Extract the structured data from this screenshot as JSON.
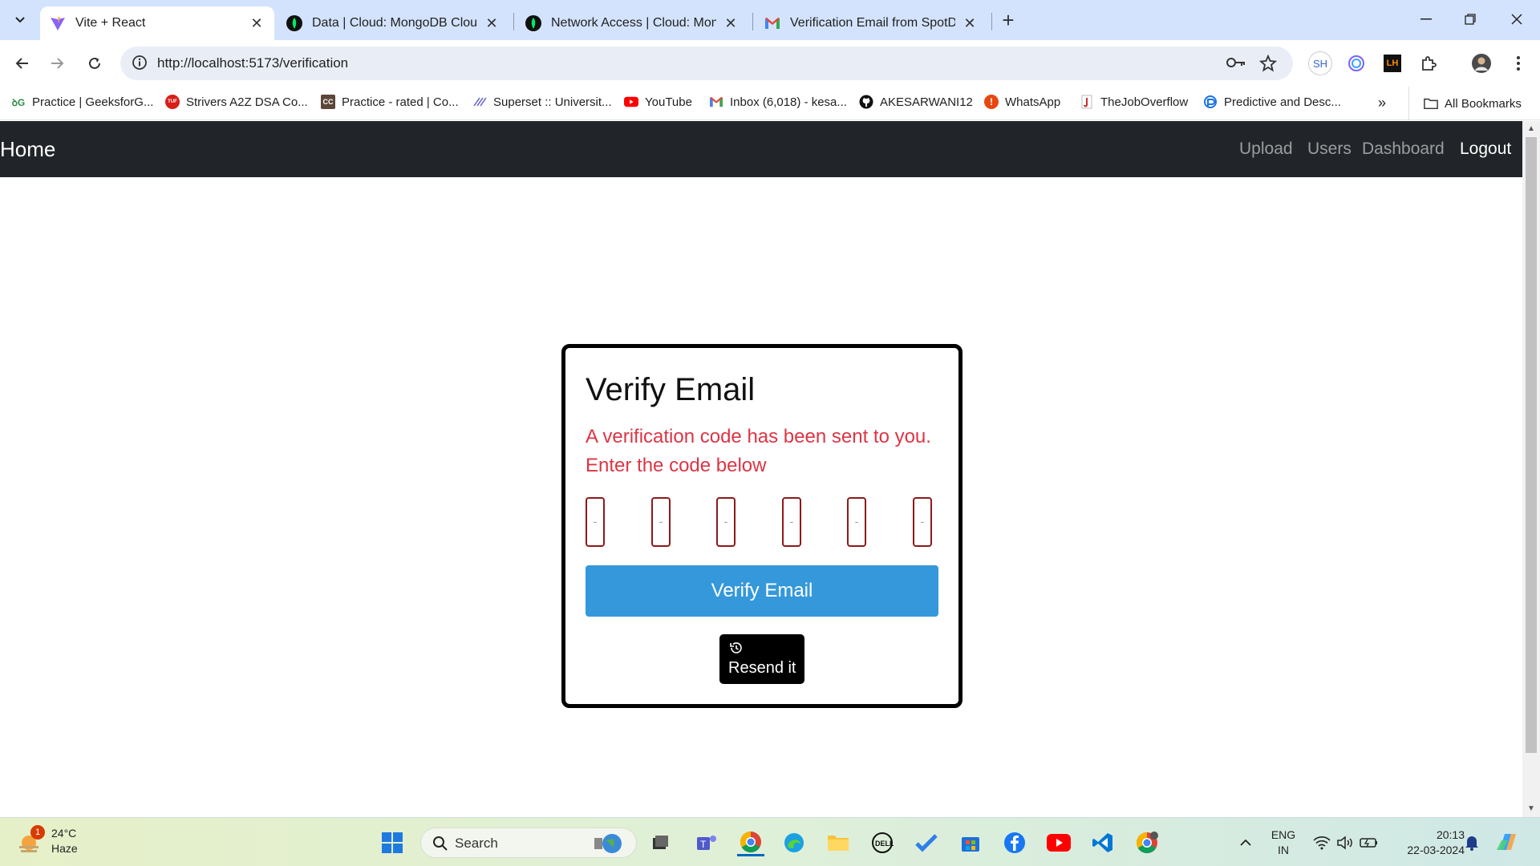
{
  "browser": {
    "tabs": [
      {
        "title": "Vite + React",
        "active": true
      },
      {
        "title": "Data | Cloud: MongoDB Cloud",
        "active": false
      },
      {
        "title": "Network Access | Cloud: MongoDB",
        "active": false
      },
      {
        "title": "Verification Email from SpotDraft",
        "active": false
      }
    ],
    "url": "http://localhost:5173/verification",
    "profile_ext": "SH",
    "bookmarks": [
      "Practice | GeeksforG...",
      "Strivers A2Z DSA Co...",
      "Practice - rated | Co...",
      "Superset :: Universit...",
      "YouTube",
      "Inbox (6,018) - kesa...",
      "AKESARWANI12",
      "WhatsApp",
      "TheJobOverflow",
      "Predictive and Desc..."
    ],
    "all_bookmarks": "All Bookmarks",
    "tuf_badge": "TUF",
    "cc_badge": "CC"
  },
  "app": {
    "brand": "Home",
    "nav": [
      "Upload",
      "Users",
      "Dashboard",
      "Logout"
    ],
    "card": {
      "title": "Verify Email",
      "message": "A verification code has been sent to you. Enter the code below",
      "otp_placeholder": "-",
      "verify_label": "Verify Email",
      "resend_label": "Resend it"
    },
    "colors": {
      "navbar": "#212529",
      "error": "#dc3545",
      "primary": "#3498db"
    }
  },
  "taskbar": {
    "weather_temp": "24°C",
    "weather_desc": "Haze",
    "weather_badge": "1",
    "search_label": "Search",
    "lang_top": "ENG",
    "lang_bottom": "IN",
    "time": "20:13",
    "date": "22-03-2024"
  }
}
